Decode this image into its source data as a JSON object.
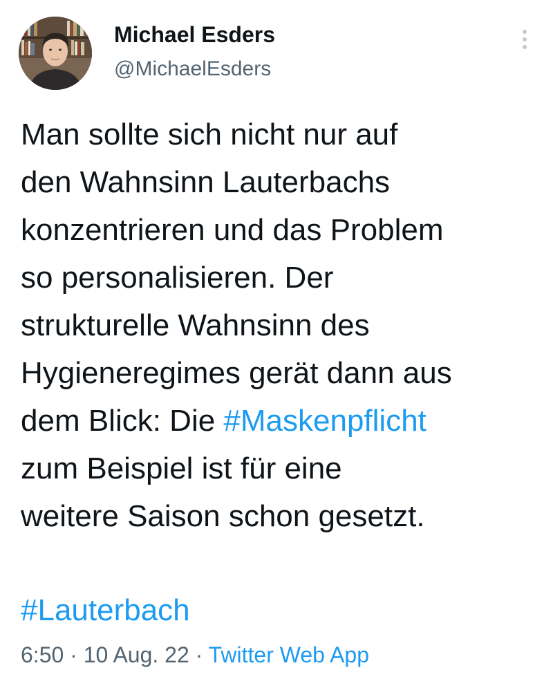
{
  "author": {
    "display_name": "Michael Esders",
    "handle": "@MichaelEsders",
    "avatar_icon": "profile-photo"
  },
  "more_icon": "vertical-dots-icon",
  "tweet": {
    "lines": [
      "Man sollte sich nicht nur auf",
      "den Wahnsinn Lauterbachs",
      "konzentrieren und das Problem",
      "so personalisieren. Der",
      "strukturelle Wahnsinn des",
      "Hygieneregimes gerät dann aus"
    ],
    "line7_prefix": "dem Blick: Die ",
    "hashtag_inline": "#Maskenpflicht",
    "lines_after": [
      "zum Beispiel ist für eine",
      "weitere Saison schon gesetzt."
    ],
    "hashtag_footer": "#Lauterbach"
  },
  "meta": {
    "time": "6:50",
    "separator1": " · ",
    "date": "10 Aug. 22",
    "separator2": " · ",
    "source": "Twitter Web App"
  },
  "colors": {
    "link": "#1d9bf0",
    "text": "#0f1419",
    "secondary": "#536471"
  }
}
